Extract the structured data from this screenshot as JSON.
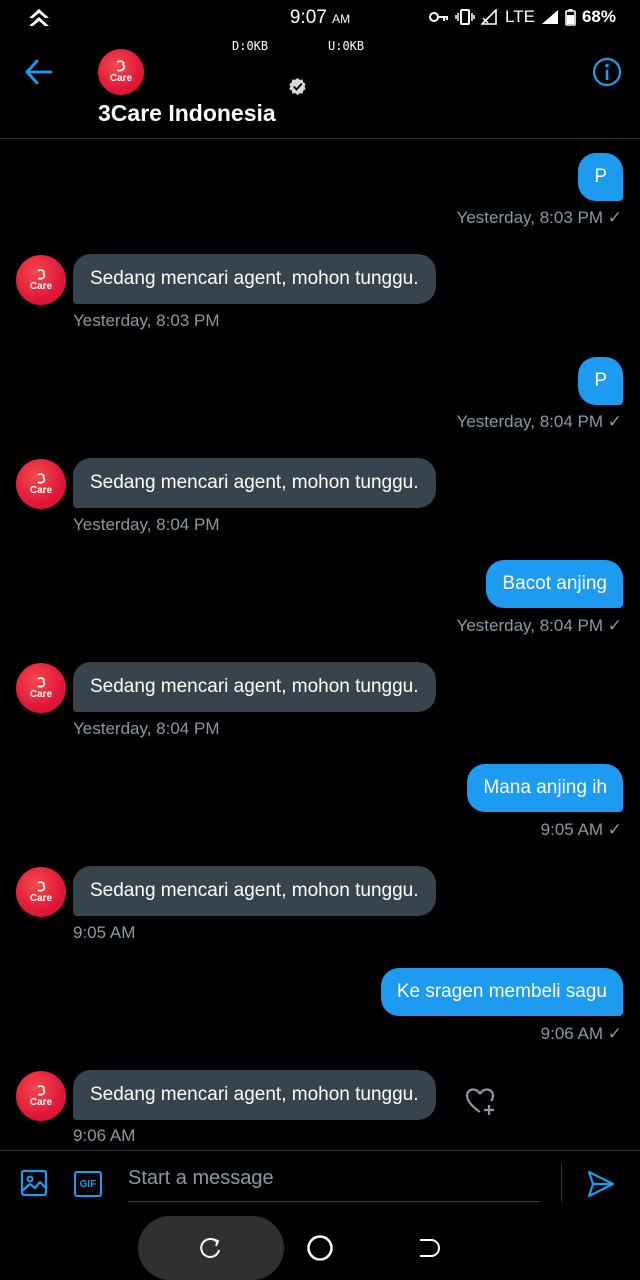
{
  "status_bar": {
    "time": "9:07",
    "ampm": "AM",
    "network": "LTE",
    "battery": "68%",
    "download": "D:0KB",
    "upload": "U:0KB"
  },
  "header": {
    "avatar_text": "Care",
    "title": "3Care Indonesia"
  },
  "messages": [
    {
      "dir": "out",
      "text": "P",
      "time": "Yesterday, 8:03 PM ✓"
    },
    {
      "dir": "in",
      "text": "Sedang mencari agent, mohon tunggu.",
      "time": "Yesterday, 8:03 PM"
    },
    {
      "dir": "out",
      "text": "P",
      "time": "Yesterday, 8:04 PM ✓"
    },
    {
      "dir": "in",
      "text": "Sedang mencari agent, mohon tunggu.",
      "time": "Yesterday, 8:04 PM"
    },
    {
      "dir": "out",
      "text": "Bacot anjing",
      "time": "Yesterday, 8:04 PM ✓"
    },
    {
      "dir": "in",
      "text": "Sedang mencari agent, mohon tunggu.",
      "time": "Yesterday, 8:04 PM"
    },
    {
      "dir": "out",
      "text": "Mana anjing ih",
      "time": "9:05 AM ✓"
    },
    {
      "dir": "in",
      "text": "Sedang mencari agent, mohon tunggu.",
      "time": "9:05 AM"
    },
    {
      "dir": "out",
      "text": "Ke sragen membeli sagu",
      "time": "9:06 AM ✓"
    },
    {
      "dir": "in",
      "text": "Sedang mencari agent, mohon tunggu.",
      "time": "9:06 AM"
    }
  ],
  "composer": {
    "placeholder": "Start a message",
    "gif_label": "GIF"
  },
  "colors": {
    "accent": "#1d9bf0",
    "incoming_bubble": "#38444d",
    "timestamp": "#8b98a5",
    "avatar_red": "#e01839"
  }
}
